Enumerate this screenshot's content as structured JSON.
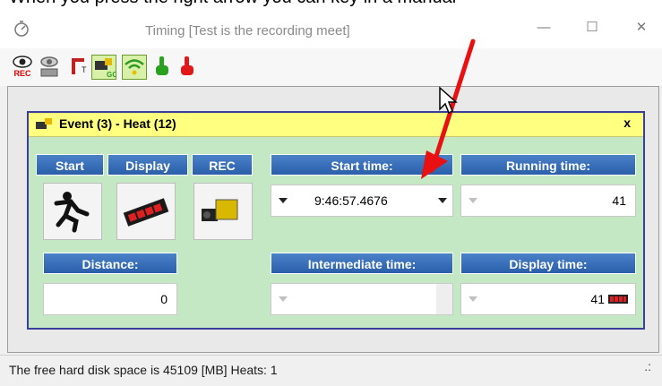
{
  "caption_fragment": "When you press the right arrow you can key in a manual",
  "window": {
    "title": "Timing [Test is the recording meet]"
  },
  "toolbar": {
    "icons": [
      "rec-eye-icon",
      "camera-icon",
      "timer-icon",
      "go-icon",
      "wifi-icon",
      "green-hand-icon",
      "red-hand-icon"
    ],
    "rec_label": "REC",
    "go_label": "GO"
  },
  "panel": {
    "title": "Event (3) - Heat (12)",
    "close_label": "x",
    "headers": {
      "start": "Start",
      "display": "Display",
      "rec": "REC",
      "start_time": "Start time:",
      "running_time": "Running time:",
      "distance": "Distance:",
      "intermediate_time": "Intermediate time:",
      "display_time": "Display time:"
    },
    "values": {
      "start_time": "9:46:57.4676",
      "running_time": "41",
      "distance": "0",
      "intermediate_time": "",
      "display_time": "41"
    }
  },
  "status": {
    "text": "The free hard disk space is 45109 [MB]  Heats: 1",
    "dots": ".:"
  },
  "colors": {
    "accent": "#e81010",
    "panel_bg": "#c4e8c4",
    "header_blue": "#2a5eaa",
    "panel_head": "#ffff80"
  }
}
